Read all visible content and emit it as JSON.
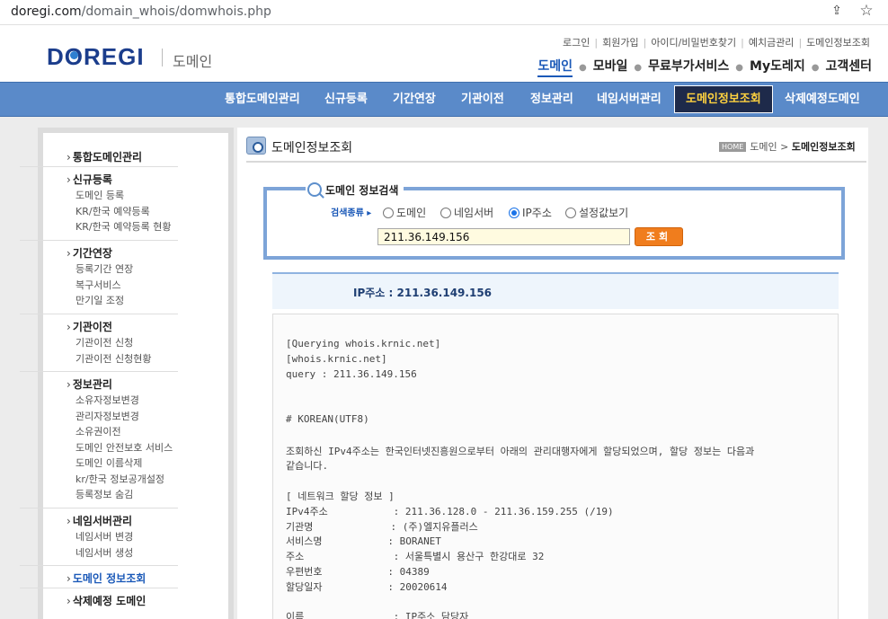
{
  "browser": {
    "url_host": "doregi.com",
    "url_path": "/domain_whois/domwhois.php"
  },
  "header": {
    "logo": "DOREGI",
    "logo_sub": "도메인",
    "toplinks": [
      "로그인",
      "회원가입",
      "아이디/비밀번호찾기",
      "예치금관리",
      "도메인정보조회"
    ],
    "menu": [
      "도메인",
      "모바일",
      "무료부가서비스",
      "My도레지",
      "고객센터"
    ],
    "menu_active": "도메인"
  },
  "nav": {
    "items": [
      "통합도메인관리",
      "신규등록",
      "기간연장",
      "기관이전",
      "정보관리",
      "네임서버관리",
      "도메인정보조회",
      "삭제예정도메인"
    ],
    "active": "도메인정보조회",
    "bar_color": "#5a8ac9",
    "active_text_color": "#ffd23f"
  },
  "sidebar": {
    "groups": [
      {
        "head": "통합도메인관리",
        "subs": []
      },
      {
        "head": "신규등록",
        "subs": [
          "도메인 등록",
          "KR/한국 예약등록",
          "KR/한국 예약등록 현황"
        ]
      },
      {
        "head": "기간연장",
        "subs": [
          "등록기간 연장",
          "복구서비스",
          "만기일 조정"
        ]
      },
      {
        "head": "기관이전",
        "subs": [
          "기관이전 신청",
          "기관이전 신청현황"
        ]
      },
      {
        "head": "정보관리",
        "subs": [
          "소유자정보변경",
          "관리자정보변경",
          "소유권이전",
          "도메인 안전보호 서비스",
          "도메인 이름삭제",
          "kr/한국 정보공개설정",
          "등록정보 숨김"
        ]
      },
      {
        "head": "네임서버관리",
        "subs": [
          "네임서버 변경",
          "네임서버 생성"
        ]
      },
      {
        "head": "도메인 정보조회",
        "subs": [],
        "active": true
      },
      {
        "head": "삭제예정 도메인",
        "subs": []
      }
    ]
  },
  "content": {
    "title": "도메인정보조회",
    "breadcrumb_home": "HOME",
    "breadcrumb": [
      "도메인",
      "도메인정보조회"
    ],
    "search": {
      "legend": "도메인 정보검색",
      "type_label": "검색종류 ▸",
      "options": [
        "도메인",
        "네임서버",
        "IP주소",
        "설정값보기"
      ],
      "selected": "IP주소",
      "value": "211.36.149.156",
      "button": "조회"
    },
    "ip_label": "IP주소 : 211.36.149.156",
    "whois_lines": [
      "[Querying whois.krnic.net]",
      "[whois.krnic.net]",
      "query : 211.36.149.156",
      "",
      "",
      "# KOREAN(UTF8)",
      "",
      "조회하신 IPv4주소는 한국인터넷진흥원으로부터 아래의 관리대행자에게 할당되었으며, 할당 정보는 다음과",
      "같습니다.",
      "",
      "[ 네트워크 할당 정보 ]",
      "IPv4주소           : 211.36.128.0 - 211.36.159.255 (/19)",
      "기관명             : (주)엘지유플러스",
      "서비스명           : BORANET",
      "주소               : 서울특별시 용산구 한강대로 32",
      "우편번호           : 04389",
      "할당일자           : 20020614",
      "",
      "이름               : IP주소 담당자"
    ]
  }
}
